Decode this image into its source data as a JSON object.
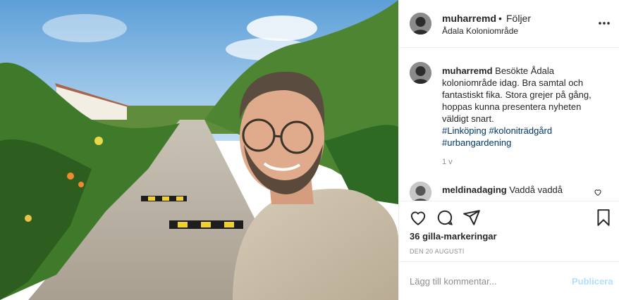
{
  "post": {
    "username": "muharremd",
    "dot": "•",
    "follow_label": "Följer",
    "location": "Ådala Koloniområde",
    "more_icon": "more-horizontal-icon",
    "caption_username": "muharremd",
    "caption_text": "Besökte Ådala koloniområde idag. Bra samtal och fantastiskt fika. Stora grejer på gång, hoppas kunna presentera nyheten väldigt snart.",
    "hashtags": "#Linköping #koloniträdgård #urbangardening",
    "caption_time": "1 v"
  },
  "comments": [
    {
      "username": "meldinadaging",
      "text": "Vaddå vaddå"
    }
  ],
  "actions": {
    "icons": [
      "heart-icon",
      "comment-icon",
      "share-icon",
      "bookmark-icon"
    ],
    "likes": "36 gilla-markeringar",
    "date": "DEN 20 AUGUSTI"
  },
  "add_comment": {
    "placeholder": "Lägg till kommentar...",
    "publish_label": "Publicera"
  },
  "colors": {
    "link": "#00376b",
    "publish_disabled": "#b2dffc",
    "secondary_text": "#8e8e8e",
    "border": "#efefef"
  }
}
